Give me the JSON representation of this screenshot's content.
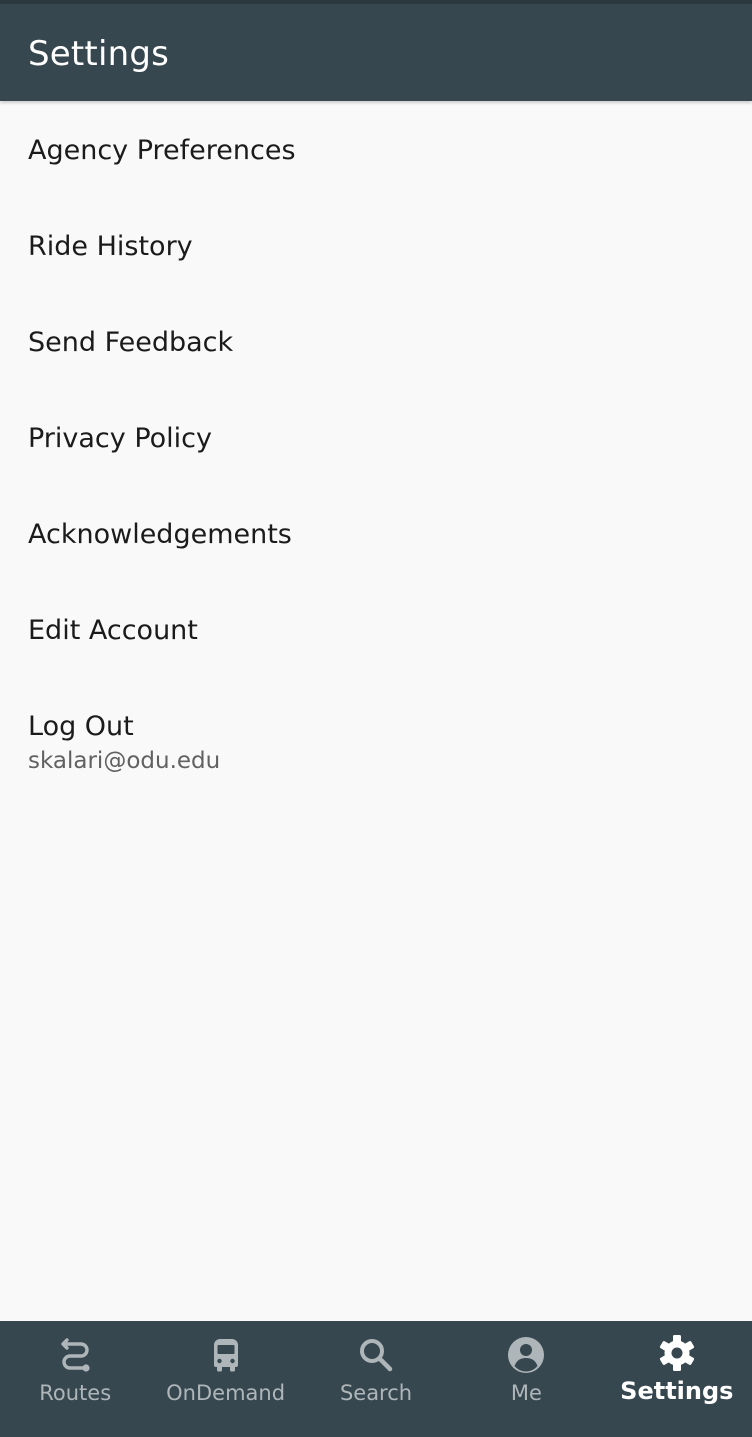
{
  "header": {
    "title": "Settings"
  },
  "menu": {
    "items": [
      {
        "label": "Agency Preferences"
      },
      {
        "label": "Ride History"
      },
      {
        "label": "Send Feedback"
      },
      {
        "label": "Privacy Policy"
      },
      {
        "label": "Acknowledgements"
      },
      {
        "label": "Edit Account"
      },
      {
        "label": "Log Out",
        "sublabel": "skalari@odu.edu"
      }
    ]
  },
  "bottom_nav": {
    "items": [
      {
        "label": "Routes",
        "icon": "routes-icon"
      },
      {
        "label": "OnDemand",
        "icon": "bus-icon"
      },
      {
        "label": "Search",
        "icon": "search-icon"
      },
      {
        "label": "Me",
        "icon": "account-circle-icon"
      },
      {
        "label": "Settings",
        "icon": "gear-icon",
        "active": true
      }
    ]
  },
  "colors": {
    "header_bg": "#37474f",
    "page_bg": "#f9f9f9",
    "nav_inactive": "#aeb6ba",
    "nav_active": "#ffffff"
  }
}
